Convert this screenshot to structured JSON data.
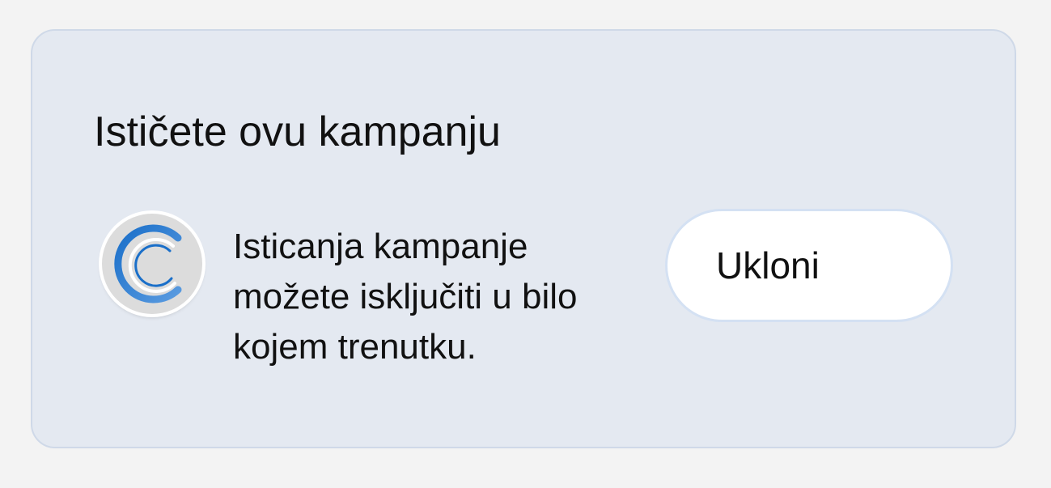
{
  "card": {
    "title": "Ističete ovu kampanju",
    "message": "Isticanja kampanje možete isključiti u bilo kojem trenutku.",
    "remove_label": "Ukloni",
    "status_icon": "progress-ring-icon",
    "accent_color": "#1a6fc9"
  }
}
